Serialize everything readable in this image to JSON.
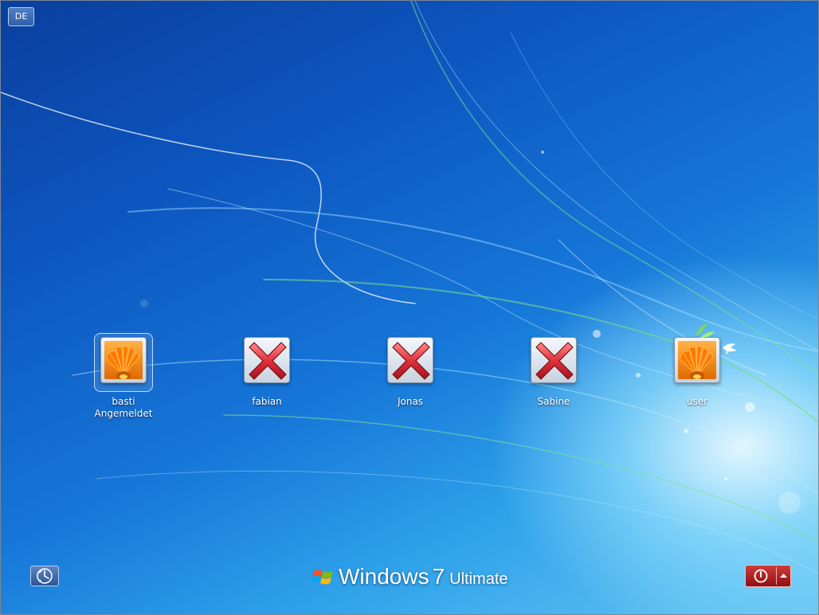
{
  "language_button": {
    "label": "DE"
  },
  "users": [
    {
      "name": "basti",
      "status": "Angemeldet",
      "picture": "flower-picture",
      "selected": true
    },
    {
      "name": "fabian",
      "status": "",
      "picture": "red-x-icon",
      "selected": false
    },
    {
      "name": "Jonas",
      "status": "",
      "picture": "red-x-icon",
      "selected": false
    },
    {
      "name": "Sabine",
      "status": "",
      "picture": "red-x-icon",
      "selected": false
    },
    {
      "name": "user",
      "status": "",
      "picture": "flower-picture",
      "selected": false
    }
  ],
  "branding": {
    "product": "Windows",
    "version": "7",
    "edition": "Ultimate"
  },
  "icons": {
    "ease_of_access": "ease-of-access-icon",
    "power": "power-icon",
    "power_options": "chevron-up-icon",
    "windows_logo": "windows-flag-icon"
  },
  "colors": {
    "background_dark": "#0a3f9e",
    "background_light": "#66c6f3",
    "power_button": "#b72226",
    "error_x": "#e0313c"
  }
}
